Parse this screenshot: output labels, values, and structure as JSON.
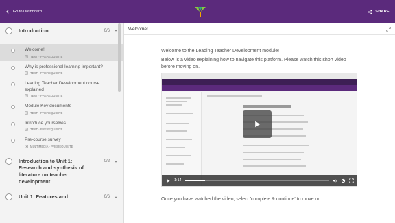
{
  "topbar": {
    "back_label": "Go to Dashboard",
    "share_label": "SHARE",
    "color": "#5b2a7c"
  },
  "sidebar": {
    "sections": [
      {
        "title": "Introduction",
        "count": "0/6",
        "lessons": [
          {
            "title": "Welcome!",
            "meta": "TEXT · PREREQUISITE",
            "active": true
          },
          {
            "title": "Why is professional learning important?",
            "meta": "TEXT · PREREQUISITE"
          },
          {
            "title": "Leading Teacher Development course explained",
            "meta": "TEXT · PREREQUISITE"
          },
          {
            "title": "Module Key documents",
            "meta": "TEXT · PREREQUISITE"
          },
          {
            "title": "Introduce yourselves",
            "meta": "TEXT · PREREQUISITE"
          },
          {
            "title": "Pre-course survey",
            "meta": "MULTIMEDIA · PREREQUISITE"
          }
        ]
      },
      {
        "title": "Introduction to Unit 1: Research and synthesis of literature on teacher development",
        "count": "0/2"
      },
      {
        "title": "Unit 1: Features and",
        "count": "0/6"
      }
    ]
  },
  "main": {
    "title": "Welcome!",
    "para1": "Welcome to the Leading Teacher Development module!",
    "para2": "Below is a video explaining how to navigate this platform. Please watch this short video before moving on.",
    "video": {
      "time": "1:14",
      "progress": 0.14
    },
    "after": "Once you have watched the video, select 'complete & continue' to move on...."
  }
}
